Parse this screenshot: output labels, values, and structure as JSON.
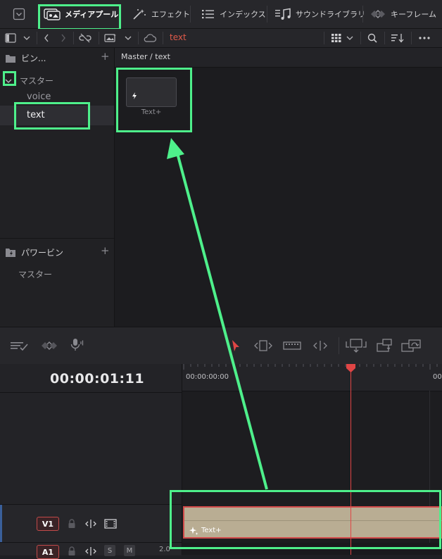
{
  "topbar": {
    "tabs": [
      {
        "label": "メディアプール",
        "icon": "media-pool-icon"
      },
      {
        "label": "エフェクト",
        "icon": "effects-wand-icon"
      },
      {
        "label": "インデックス",
        "icon": "index-list-icon"
      },
      {
        "label": "サウンドライブラリ",
        "icon": "sound-library-icon"
      },
      {
        "label": "キーフレーム",
        "icon": "keyframe-icon"
      }
    ]
  },
  "toolbar2": {
    "current_bin": "text"
  },
  "bins": {
    "header": "ビン...",
    "master": "マスター",
    "items": [
      "voice",
      "text"
    ],
    "powerbin_header": "パワービン",
    "powerbin_master": "マスター"
  },
  "main": {
    "breadcrumb": "Master / text",
    "clip_label": "Text+"
  },
  "timeline": {
    "timecode": "00:00:01:11",
    "ruler_start": "00:00:00:00",
    "ruler_next": "00",
    "video_track": "V1",
    "audio_track": "A1",
    "audio_solo": "S",
    "audio_mute": "M",
    "audio_level": "2.0",
    "clip_label": "Text+"
  },
  "colors": {
    "accent_green": "#4ef08b",
    "playhead_red": "#e04545",
    "bin_name_red": "#e05a4a",
    "clip_beige": "#b9ad93"
  }
}
